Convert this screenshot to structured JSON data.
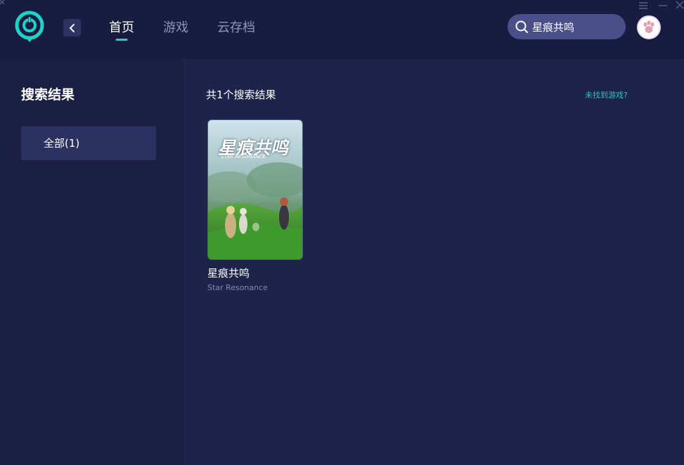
{
  "header": {
    "nav_tabs": [
      {
        "label": "首页",
        "active": true
      },
      {
        "label": "游戏",
        "active": false
      },
      {
        "label": "云存档",
        "active": false
      }
    ],
    "search": {
      "value": "星痕共鸣",
      "icon": "search-icon"
    },
    "icons": {
      "back": "chevron-left-icon",
      "menu": "menu-icon",
      "minimize": "minimize-icon",
      "close": "close-icon",
      "avatar": "paw-avatar-icon"
    }
  },
  "sidebar": {
    "title": "搜索结果",
    "filters": [
      {
        "label": "全部(1)",
        "active": true
      }
    ]
  },
  "main": {
    "result_count": "共1个搜索结果",
    "not_found_link": "未找到游戏?",
    "results": [
      {
        "name": "星痕共鸣",
        "subtitle": "Star Resonance",
        "cover_title": "星痕共鸣",
        "cover_subtitle": "STAR RESONANCE"
      }
    ]
  },
  "colors": {
    "accent": "#1ed2c6",
    "background": "#1c2147",
    "sidebar": "#1b1f43",
    "search_bg": "#4a4f8a"
  }
}
